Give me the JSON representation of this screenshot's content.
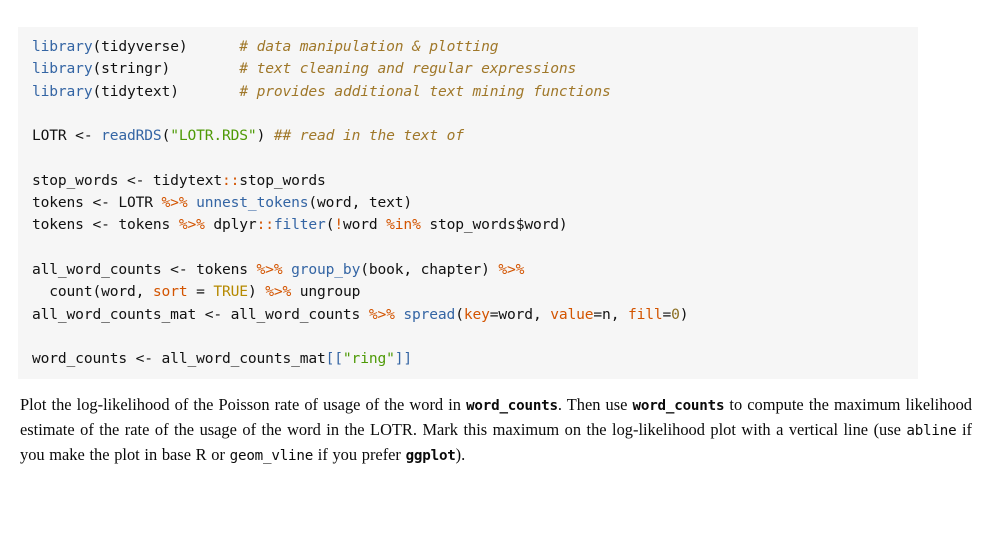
{
  "document": {
    "code_block": {
      "background_color": "#f6f6f6",
      "language": "R",
      "lines": [
        {
          "id": "l1",
          "text": "library(tidyverse)      # data manipulation & plotting"
        },
        {
          "id": "l2",
          "text": "library(stringr)        # text cleaning and regular expressions"
        },
        {
          "id": "l3",
          "text": "library(tidytext)       # provides additional text mining functions"
        },
        {
          "id": "l4",
          "text": ""
        },
        {
          "id": "l5",
          "text": "LOTR <- readRDS(\"LOTR.RDS\") ## read in the text of"
        },
        {
          "id": "l6",
          "text": ""
        },
        {
          "id": "l7",
          "text": "stop_words <- tidytext::stop_words"
        },
        {
          "id": "l8",
          "text": "tokens <- LOTR %>% unnest_tokens(word, text)"
        },
        {
          "id": "l9",
          "text": "tokens <- tokens %>% dplyr::filter(!word %in% stop_words$word)"
        },
        {
          "id": "l10",
          "text": ""
        },
        {
          "id": "l11",
          "text": "all_word_counts <- tokens %>% group_by(book, chapter) %>%"
        },
        {
          "id": "l12",
          "text": "  count(word, sort = TRUE) %>% ungroup"
        },
        {
          "id": "l13",
          "text": "all_word_counts_mat <- all_word_counts %>% spread(key=word, value=n, fill=0)"
        },
        {
          "id": "l14",
          "text": ""
        },
        {
          "id": "l15",
          "text": "word_counts <- all_word_counts_mat[[\"ring\"]]"
        }
      ],
      "segments": {
        "l1": [
          {
            "t": "library",
            "c": "tok-fn"
          },
          {
            "t": "(tidyverse)",
            "c": "tok-plain"
          },
          {
            "t": "      ",
            "c": "tok-plain"
          },
          {
            "t": "# data manipulation & plotting",
            "c": "tok-cmt"
          }
        ],
        "l2": [
          {
            "t": "library",
            "c": "tok-fn"
          },
          {
            "t": "(stringr)",
            "c": "tok-plain"
          },
          {
            "t": "        ",
            "c": "tok-plain"
          },
          {
            "t": "# text cleaning and regular expressions",
            "c": "tok-cmt"
          }
        ],
        "l3": [
          {
            "t": "library",
            "c": "tok-fn"
          },
          {
            "t": "(tidytext)",
            "c": "tok-plain"
          },
          {
            "t": "       ",
            "c": "tok-plain"
          },
          {
            "t": "# provides additional text mining functions",
            "c": "tok-cmt"
          }
        ],
        "l4": [
          {
            "t": " ",
            "c": "tok-plain"
          }
        ],
        "l5": [
          {
            "t": "LOTR <- ",
            "c": "tok-plain"
          },
          {
            "t": "readRDS",
            "c": "tok-fn"
          },
          {
            "t": "(",
            "c": "tok-plain"
          },
          {
            "t": "\"LOTR.RDS\"",
            "c": "tok-str"
          },
          {
            "t": ") ",
            "c": "tok-plain"
          },
          {
            "t": "## read in the text of",
            "c": "tok-cmt"
          }
        ],
        "l6": [
          {
            "t": " ",
            "c": "tok-plain"
          }
        ],
        "l7": [
          {
            "t": "stop_words <- tidytext",
            "c": "tok-plain"
          },
          {
            "t": "::",
            "c": "tok-op"
          },
          {
            "t": "stop_words",
            "c": "tok-plain"
          }
        ],
        "l8": [
          {
            "t": "tokens <- LOTR ",
            "c": "tok-plain"
          },
          {
            "t": "%>%",
            "c": "tok-op"
          },
          {
            "t": " ",
            "c": "tok-plain"
          },
          {
            "t": "unnest_tokens",
            "c": "tok-fn"
          },
          {
            "t": "(word, text)",
            "c": "tok-plain"
          }
        ],
        "l9": [
          {
            "t": "tokens <- tokens ",
            "c": "tok-plain"
          },
          {
            "t": "%>%",
            "c": "tok-op"
          },
          {
            "t": " dplyr",
            "c": "tok-plain"
          },
          {
            "t": "::",
            "c": "tok-op"
          },
          {
            "t": "filter",
            "c": "tok-fn"
          },
          {
            "t": "(",
            "c": "tok-plain"
          },
          {
            "t": "!",
            "c": "tok-op"
          },
          {
            "t": "word ",
            "c": "tok-plain"
          },
          {
            "t": "%in%",
            "c": "tok-op"
          },
          {
            "t": " stop_words$word)",
            "c": "tok-plain"
          }
        ],
        "l10": [
          {
            "t": " ",
            "c": "tok-plain"
          }
        ],
        "l11": [
          {
            "t": "all_word_counts <- tokens ",
            "c": "tok-plain"
          },
          {
            "t": "%>%",
            "c": "tok-op"
          },
          {
            "t": " ",
            "c": "tok-plain"
          },
          {
            "t": "group_by",
            "c": "tok-fn"
          },
          {
            "t": "(book, chapter) ",
            "c": "tok-plain"
          },
          {
            "t": "%>%",
            "c": "tok-op"
          }
        ],
        "l12": [
          {
            "t": "  count(word, ",
            "c": "tok-plain"
          },
          {
            "t": "sort",
            "c": "tok-op"
          },
          {
            "t": " = ",
            "c": "tok-plain"
          },
          {
            "t": "TRUE",
            "c": "tok-const"
          },
          {
            "t": ") ",
            "c": "tok-plain"
          },
          {
            "t": "%>%",
            "c": "tok-op"
          },
          {
            "t": " ungroup",
            "c": "tok-plain"
          }
        ],
        "l13": [
          {
            "t": "all_word_counts_mat <- all_word_counts ",
            "c": "tok-plain"
          },
          {
            "t": "%>%",
            "c": "tok-op"
          },
          {
            "t": " ",
            "c": "tok-plain"
          },
          {
            "t": "spread",
            "c": "tok-fn"
          },
          {
            "t": "(",
            "c": "tok-plain"
          },
          {
            "t": "key",
            "c": "tok-op"
          },
          {
            "t": "=word, ",
            "c": "tok-plain"
          },
          {
            "t": "value",
            "c": "tok-op"
          },
          {
            "t": "=n, ",
            "c": "tok-plain"
          },
          {
            "t": "fill",
            "c": "tok-op"
          },
          {
            "t": "=",
            "c": "tok-plain"
          },
          {
            "t": "0",
            "c": "tok-num"
          },
          {
            "t": ")",
            "c": "tok-plain"
          }
        ],
        "l14": [
          {
            "t": " ",
            "c": "tok-plain"
          }
        ],
        "l15": [
          {
            "t": "word_counts <- all_word_counts_mat",
            "c": "tok-plain"
          },
          {
            "t": "[[",
            "c": "tok-fn"
          },
          {
            "t": "\"ring\"",
            "c": "tok-str"
          },
          {
            "t": "]]",
            "c": "tok-fn"
          }
        ]
      }
    },
    "prose": {
      "segments": [
        {
          "t": "Plot the log-likelihood of the Poisson rate of usage of the word in ",
          "style": "text"
        },
        {
          "t": "word_counts",
          "style": "code-bold"
        },
        {
          "t": ". Then use ",
          "style": "text"
        },
        {
          "t": "word_counts",
          "style": "code-bold"
        },
        {
          "t": " to compute the maximum likelihood estimate of the rate of the usage of the word in the LOTR. Mark this maximum on the log-likelihood plot with a vertical line (use ",
          "style": "text"
        },
        {
          "t": "abline",
          "style": "code"
        },
        {
          "t": " if you make the plot in base R or ",
          "style": "text"
        },
        {
          "t": "geom_vline",
          "style": "code"
        },
        {
          "t": " if you prefer ",
          "style": "text"
        },
        {
          "t": "ggplot",
          "style": "code-bold"
        },
        {
          "t": ").",
          "style": "text"
        }
      ]
    }
  }
}
